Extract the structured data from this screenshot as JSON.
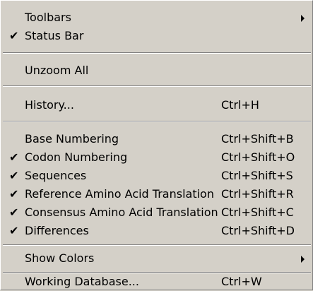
{
  "menu": {
    "toolbars": {
      "label": "Toolbars",
      "has_submenu": true
    },
    "status_bar": {
      "label": "Status Bar",
      "checked": true
    },
    "unzoom_all": {
      "label": "Unzoom All"
    },
    "history": {
      "label": "History...",
      "shortcut": "Ctrl+H"
    },
    "base_numbering": {
      "label": "Base Numbering",
      "shortcut": "Ctrl+Shift+B",
      "checked": false
    },
    "codon_numbering": {
      "label": "Codon Numbering",
      "shortcut": "Ctrl+Shift+O",
      "checked": true
    },
    "sequences": {
      "label": "Sequences",
      "shortcut": "Ctrl+Shift+S",
      "checked": true
    },
    "reference_aa": {
      "label": "Reference Amino Acid Translation",
      "shortcut": "Ctrl+Shift+R",
      "checked": true
    },
    "consensus_aa": {
      "label": "Consensus Amino Acid Translation",
      "shortcut": "Ctrl+Shift+C",
      "checked": true
    },
    "differences": {
      "label": "Differences",
      "shortcut": "Ctrl+Shift+D",
      "checked": true
    },
    "show_colors": {
      "label": "Show Colors",
      "has_submenu": true
    },
    "working_database": {
      "label": "Working Database...",
      "shortcut": "Ctrl+W"
    }
  },
  "icons": {
    "check": "✔"
  }
}
